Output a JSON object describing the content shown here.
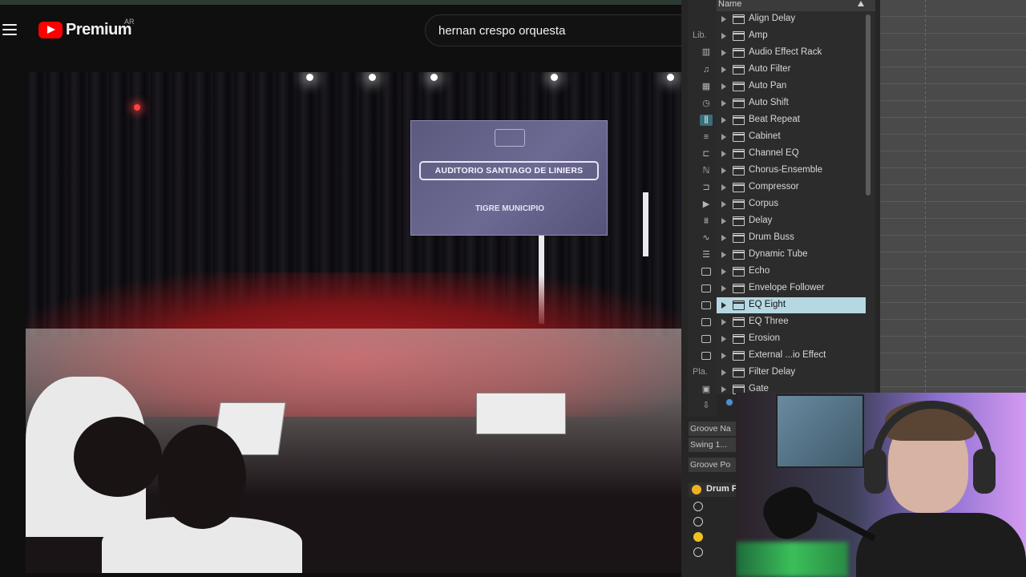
{
  "youtube": {
    "brand": "Premium",
    "country_code": "AR",
    "search_query": "hernan crespo orquesta",
    "video": {
      "screen_heading": "AUDITORIO SANTIAGO DE LINIERS",
      "screen_sub": "TIGRE MUNICIPIO"
    }
  },
  "ableton": {
    "side_labels": {
      "library": "Lib.",
      "places": "Pla."
    },
    "browser": {
      "column_header": "Name",
      "items": [
        "Align Delay",
        "Amp",
        "Audio Effect Rack",
        "Auto Filter",
        "Auto Pan",
        "Auto Shift",
        "Beat Repeat",
        "Cabinet",
        "Channel EQ",
        "Chorus-Ensemble",
        "Compressor",
        "Corpus",
        "Delay",
        "Drum Buss",
        "Dynamic Tube",
        "Echo",
        "Envelope Follower",
        "EQ Eight",
        "EQ Three",
        "Erosion",
        "External ...io Effect",
        "Filter Delay",
        "Gate"
      ],
      "selected": "EQ Eight"
    },
    "groove": {
      "name_label": "Groove Na",
      "swing_label": "Swing 1...",
      "pool_label": "Groove Po"
    },
    "drum_track": {
      "label": "Drum F"
    }
  },
  "colors": {
    "selection": "#b6d8e2",
    "youtube_red": "#ff0000",
    "track_yellow": "#f0b020"
  }
}
